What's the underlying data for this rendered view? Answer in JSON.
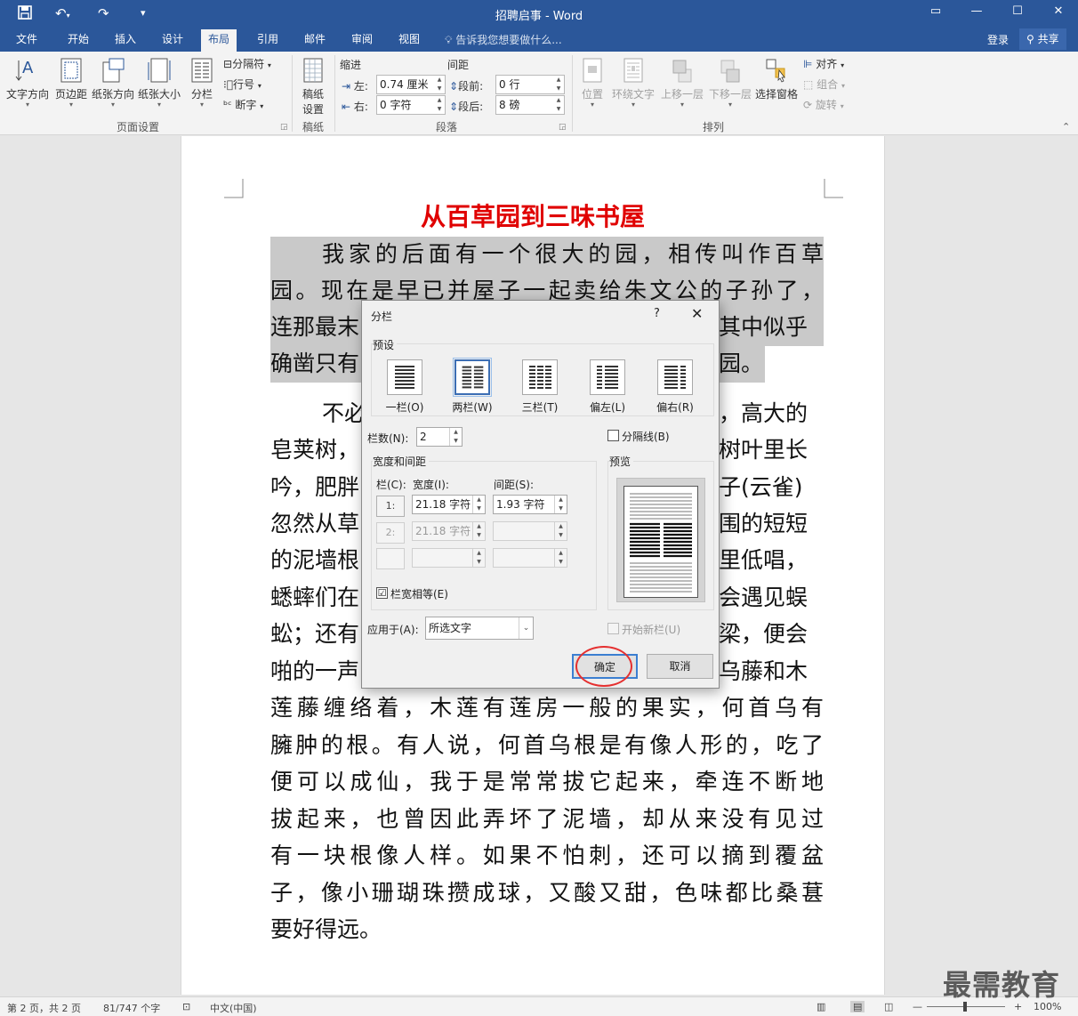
{
  "titlebar": {
    "title": "招聘启事 - Word",
    "qa_save_icon": "save-icon",
    "qa_undo_icon": "undo-icon",
    "qa_redo_icon": "redo-icon",
    "qa_customize_icon": "customize-quick-access-icon"
  },
  "tabs": [
    "文件",
    "开始",
    "插入",
    "设计",
    "布局",
    "引用",
    "邮件",
    "审阅",
    "视图"
  ],
  "active_tab": "布局",
  "tellme": "告诉我您想要做什么...",
  "login": "登录",
  "share": "共享",
  "ribbon": {
    "page_setup": {
      "label": "页面设置",
      "text_direction": "文字方向",
      "margins": "页边距",
      "orientation": "纸张方向",
      "size": "纸张大小",
      "columns": "分栏",
      "breaks": "分隔符",
      "line_numbers": "行号",
      "hyphenation": "断字"
    },
    "draft_paper": {
      "label": "稿纸",
      "button_line1": "稿纸",
      "button_line2": "设置"
    },
    "paragraph": {
      "label": "段落",
      "indent": "缩进",
      "spacing": "间距",
      "left_label": "左:",
      "left_value": "0.74 厘米",
      "right_label": "右:",
      "right_value": "0 字符",
      "before_label": "段前:",
      "before_value": "0 行",
      "after_label": "段后:",
      "after_value": "8 磅"
    },
    "arrange": {
      "label": "排列",
      "position": "位置",
      "wrap_text": "环绕文字",
      "bring_forward": "上移一层",
      "send_backward": "下移一层",
      "selection_pane": "选择窗格",
      "align": "对齐",
      "group": "组合",
      "rotate": "旋转"
    }
  },
  "document": {
    "heading": "从百草园到三味书屋",
    "lines": [
      "我家的后面有一个很大的园，相传叫作百草",
      "园。现在是早已并屋子一起卖给朱文公的子孙了，",
      "连那最末",
      "其中似乎",
      "确凿只有",
      "园。",
      "不必",
      "，高大的",
      "皂荚树，",
      "树叶里长",
      "吟，肥胖",
      "子(云雀)",
      "忽然从草",
      "围的短短",
      "的泥墙根",
      "里低唱，",
      "蟋蟀们在",
      "会遇见蜈",
      "蚣；还有",
      "梁，便会",
      "啪的一声",
      "乌藤和木",
      "莲藤缠络着，木莲有莲房一般的果实，何首乌有",
      "臃肿的根。有人说，何首乌根是有像人形的，吃了",
      "便可以成仙，我于是常常拔它起来，牵连不断地",
      "拔起来，也曾因此弄坏了泥墙，却从来没有见过",
      "有一块根像人样。如果不怕刺，还可以摘到覆盆",
      "子，像小珊瑚珠攒成球，又酸又甜，色味都比桑葚",
      "要好得远。"
    ]
  },
  "dialog": {
    "title": "分栏",
    "help": "?",
    "presets_label": "预设",
    "presets": [
      "一栏(O)",
      "两栏(W)",
      "三栏(T)",
      "偏左(L)",
      "偏右(R)"
    ],
    "selected_preset": "两栏(W)",
    "num_columns_label": "栏数(N):",
    "num_columns_value": "2",
    "line_between_label": "分隔线(B)",
    "width_spacing_label": "宽度和间距",
    "col_header": "栏(C):",
    "width_header": "宽度(I):",
    "spacing_header": "间距(S):",
    "rows": [
      {
        "col": "1:",
        "width": "21.18 字符",
        "spacing": "1.93 字符"
      },
      {
        "col": "2:",
        "width": "21.18 字符",
        "spacing": ""
      },
      {
        "col": "",
        "width": "",
        "spacing": ""
      }
    ],
    "equal_width_label": "栏宽相等(E)",
    "equal_width_checked": "☑",
    "preview_label": "预览",
    "apply_to_label": "应用于(A):",
    "apply_to_value": "所选文字",
    "start_new_column_label": "开始新栏(U)",
    "ok": "确定",
    "cancel": "取消"
  },
  "statusbar": {
    "page": "第 2 页，共 2 页",
    "words": "81/747 个字",
    "language": "中文(中国)",
    "zoom": "100%"
  },
  "watermark": "最需教育"
}
